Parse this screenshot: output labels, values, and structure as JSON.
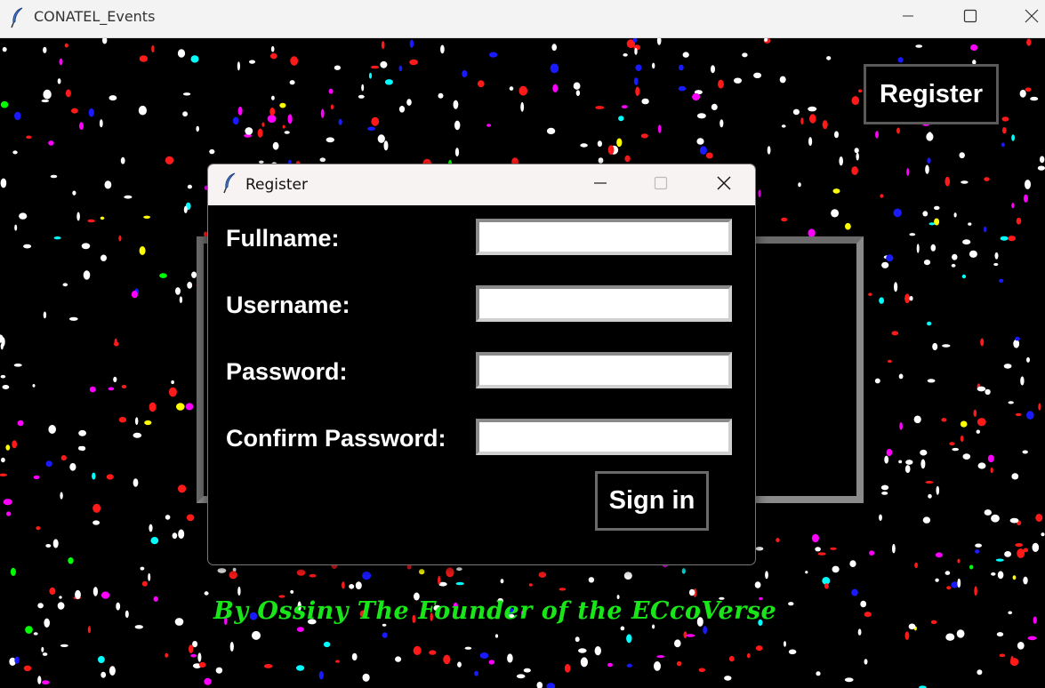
{
  "main_window": {
    "title": "CONATEL_Events",
    "icon": "feather-icon",
    "controls": [
      "minimize-icon",
      "maximize-icon",
      "close-icon"
    ]
  },
  "main": {
    "register_button_label": "Register",
    "footer_text": "By Ossiny The Founder of the ECcoVerse",
    "colors": {
      "background": "#000000",
      "footer": "#19e619",
      "confetti": [
        "#ffffff",
        "#ff1a1a",
        "#ff00ff",
        "#1a1aff",
        "#00ffff",
        "#ffff00",
        "#00ff00"
      ]
    }
  },
  "dialog": {
    "title": "Register",
    "icon": "feather-icon",
    "controls": [
      "minimize-icon",
      "maximize-icon",
      "close-icon"
    ],
    "fields": [
      {
        "label": "Fullname:",
        "value": ""
      },
      {
        "label": "Username:",
        "value": ""
      },
      {
        "label": "Password:",
        "value": ""
      },
      {
        "label": "Confirm Password:",
        "value": ""
      }
    ],
    "submit_label": "Sign in"
  }
}
